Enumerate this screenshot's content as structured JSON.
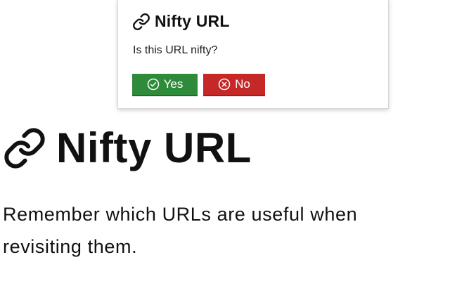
{
  "popup": {
    "title": "Nifty URL",
    "title_icon": "link-icon",
    "question": "Is this URL nifty?",
    "yes_button": {
      "label": "Yes",
      "icon": "check-circle-icon",
      "color": "#2e8b3a"
    },
    "no_button": {
      "label": "No",
      "icon": "x-circle-icon",
      "color": "#c62828"
    }
  },
  "main": {
    "title": "Nifty URL",
    "title_icon": "link-icon",
    "description": "Remember which URLs are useful when revisiting them."
  }
}
